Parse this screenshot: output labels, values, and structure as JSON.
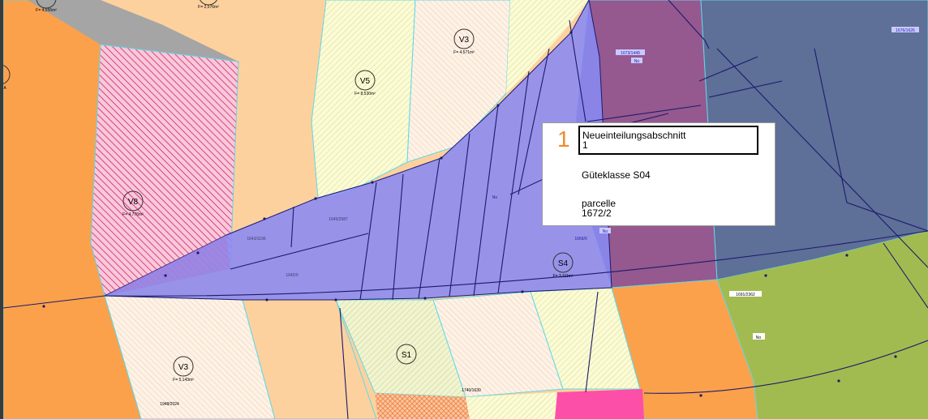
{
  "map": {
    "parcels": [
      {
        "id": "V3a",
        "label": "V3",
        "area": "F= 4,571m²"
      },
      {
        "id": "V5",
        "label": "V5",
        "area": "F= 8,530m²"
      },
      {
        "id": "V8",
        "label": "V8",
        "area": "F= 4,776m²"
      },
      {
        "id": "S4",
        "label": "S4",
        "area": "F= 3,111m²"
      },
      {
        "id": "S1",
        "label": "S1",
        "area": ""
      },
      {
        "id": "V3b",
        "label": "V3",
        "area": "F= 5,143m²"
      }
    ],
    "parcel_numbers": [
      "1673/1449",
      "1676/1626",
      "1669/0",
      "1691/2362",
      "1948/2024",
      "1740/1630",
      "1645/2587",
      "1642/0",
      "1643/1196"
    ],
    "no_tags": [
      "No",
      "No",
      "No",
      "No"
    ],
    "top_labels": [
      "F= 4,556m²",
      "F= 2,576m²"
    ],
    "edge_label": "A"
  },
  "popup": {
    "number": "1",
    "title": "Neueinteilungsabschnitt",
    "title_value": "1",
    "quality": "Güteklasse S04",
    "parcel_label": "parcelle",
    "parcel_value": "1672/2"
  },
  "colors": {
    "orange": "#fba14c",
    "peach": "#fdd19e",
    "yellow_hatch": "#fbfbc8",
    "purple": "#95598f",
    "navy": "#5e6f98",
    "green": "#a2bb50",
    "magenta": "#fc4fa8",
    "selection": "#8a8af4",
    "parcel_border": "#5fd8e8"
  }
}
